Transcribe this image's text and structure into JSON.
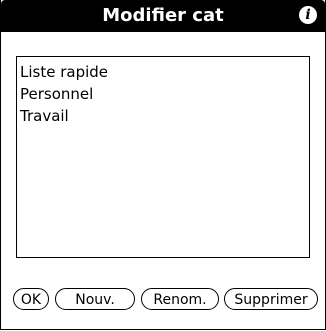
{
  "dialog": {
    "title": "Modifier cat",
    "info_icon": "i"
  },
  "list": {
    "items": [
      {
        "label": "Liste rapide"
      },
      {
        "label": "Personnel"
      },
      {
        "label": "Travail"
      }
    ]
  },
  "buttons": {
    "ok": "OK",
    "new": "Nouv.",
    "rename": "Renom.",
    "delete": "Supprimer"
  },
  "icons": {
    "info": "info-icon"
  }
}
